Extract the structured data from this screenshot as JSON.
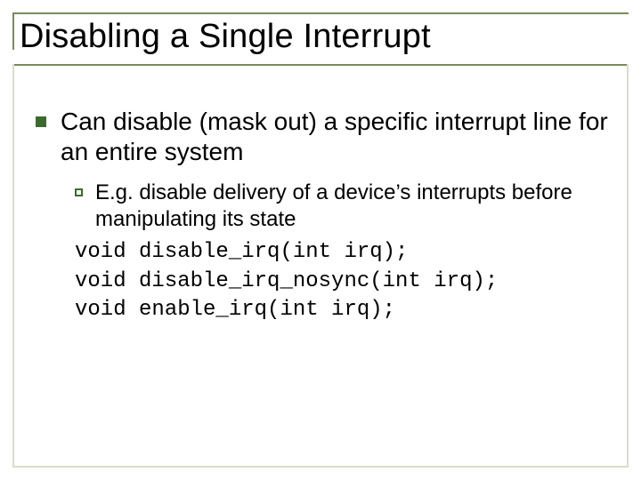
{
  "title": "Disabling a Single Interrupt",
  "point1": "Can disable (mask out) a specific interrupt line for an entire system",
  "sub1": "E.g. disable delivery of a device’s interrupts before manipulating its state",
  "code": {
    "l1": "void disable_irq(int irq);",
    "l2": "void disable_irq_nosync(int irq);",
    "l3": "void enable_irq(int irq);"
  }
}
